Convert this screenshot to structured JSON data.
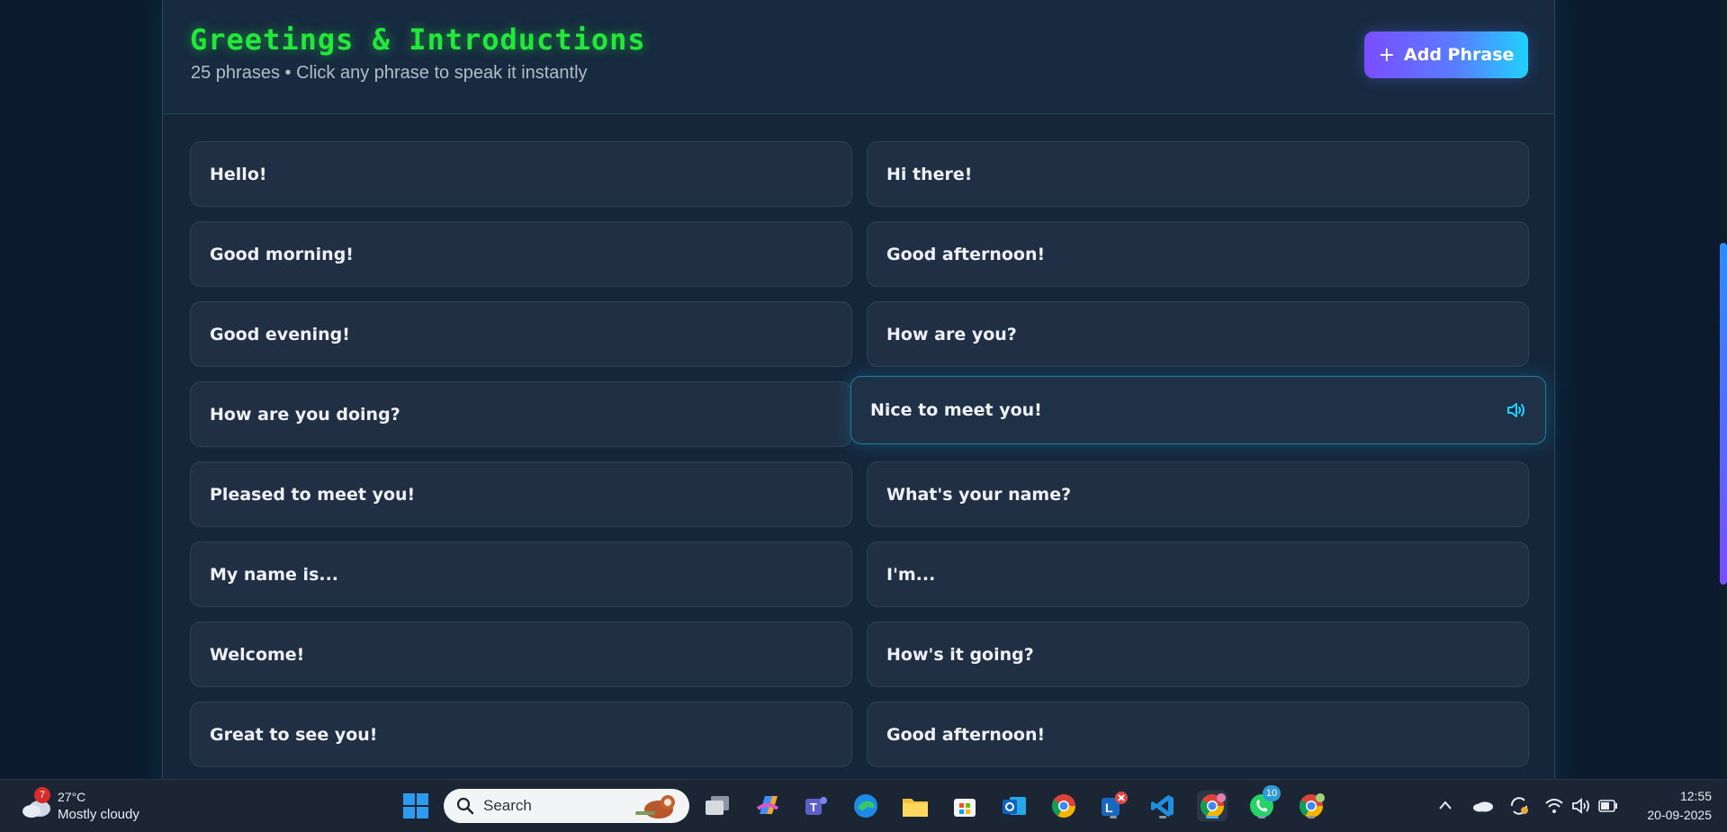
{
  "panel": {
    "title": "Greetings & Introductions",
    "subtitle": "25 phrases • Click any phrase to speak it instantly",
    "add_button_label": "Add Phrase",
    "add_button_icon": "plus-icon"
  },
  "phrases": [
    "Hello!",
    "Hi there!",
    "Good morning!",
    "Good afternoon!",
    "Good evening!",
    "How are you?",
    "How are you doing?",
    "Nice to meet you!",
    "Pleased to meet you!",
    "What's your name?",
    "My name is...",
    "I'm...",
    "Welcome!",
    "How's it going?",
    "Great to see you!",
    "Good afternoon!"
  ],
  "active_phrase_index": 7,
  "colors": {
    "title": "#22e83a",
    "accent_cyan": "#1fd1ff",
    "accent_purple": "#7b4dff",
    "card_bg": "#202f43",
    "page_bg": "#0c1a2d"
  },
  "taskbar": {
    "weather": {
      "temp": "27°C",
      "condition": "Mostly cloudy",
      "badge": "7"
    },
    "search_placeholder": "Search",
    "whatsapp_badge": "10",
    "time": "12:55",
    "date": "20-09-2025",
    "icons": [
      "windows-start-icon",
      "search-icon",
      "task-view-icon",
      "copilot-icon",
      "teams-icon",
      "edge-icon",
      "file-explorer-icon",
      "store-icon",
      "outlook-icon",
      "chrome-icon",
      "lens-icon",
      "vscode-icon",
      "chrome-active-icon",
      "whatsapp-icon",
      "chrome-profile-icon",
      "chevron-up-icon",
      "onedrive-icon",
      "sync-icon",
      "wifi-icon",
      "volume-icon",
      "battery-icon"
    ]
  }
}
